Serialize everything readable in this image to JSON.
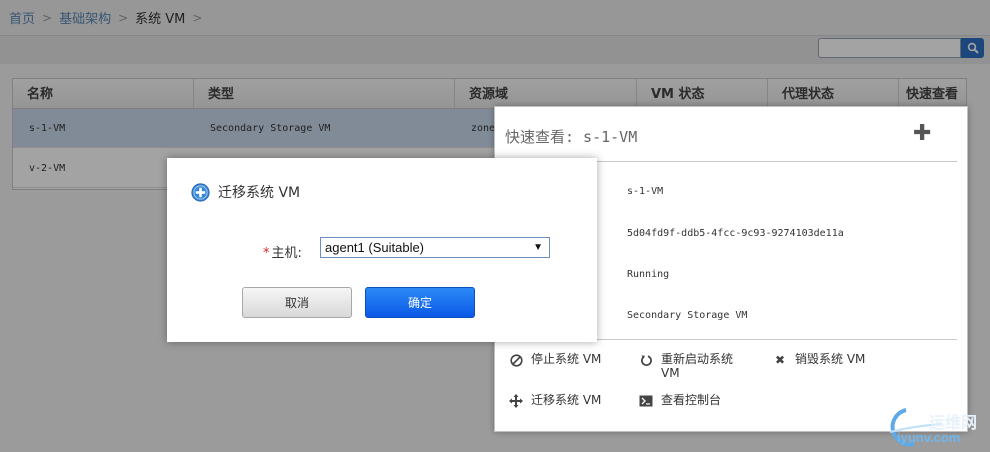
{
  "breadcrumb": {
    "home": "首页",
    "infra": "基础架构",
    "current": "系统 VM"
  },
  "grid": {
    "headers": {
      "name": "名称",
      "type": "类型",
      "zone": "资源域",
      "vm_state": "VM 状态",
      "agent_state": "代理状态",
      "quickview": "快速查看"
    },
    "rows": [
      {
        "name": "s-1-VM",
        "type": "Secondary Storage VM",
        "zone": "zone"
      },
      {
        "name": "v-2-VM"
      }
    ]
  },
  "quickview": {
    "title": "快速查看: s-1-VM",
    "name": "s-1-VM",
    "id": "5d04fd9f-ddb5-4fcc-9c93-9274103de11a",
    "state": "Running",
    "type": "Secondary Storage VM",
    "actions": {
      "stop": "停止系统 VM",
      "reboot_line1": "重新启动系统",
      "reboot_line2": "VM",
      "destroy": "销毁系统 VM",
      "migrate": "迁移系统 VM",
      "console": "查看控制台"
    }
  },
  "dialog": {
    "title": "迁移系统 VM",
    "host_label": "主机:",
    "required_mark": "*",
    "host_selected": "agent1 (Suitable)",
    "cancel": "取消",
    "ok": "确定"
  },
  "watermark": {
    "text1": "运维网",
    "text2": "iyunv.com"
  },
  "colors": {
    "primary_button": "#0a58e6",
    "link": "#5a87b8",
    "selected_row": "#cad9ee"
  }
}
